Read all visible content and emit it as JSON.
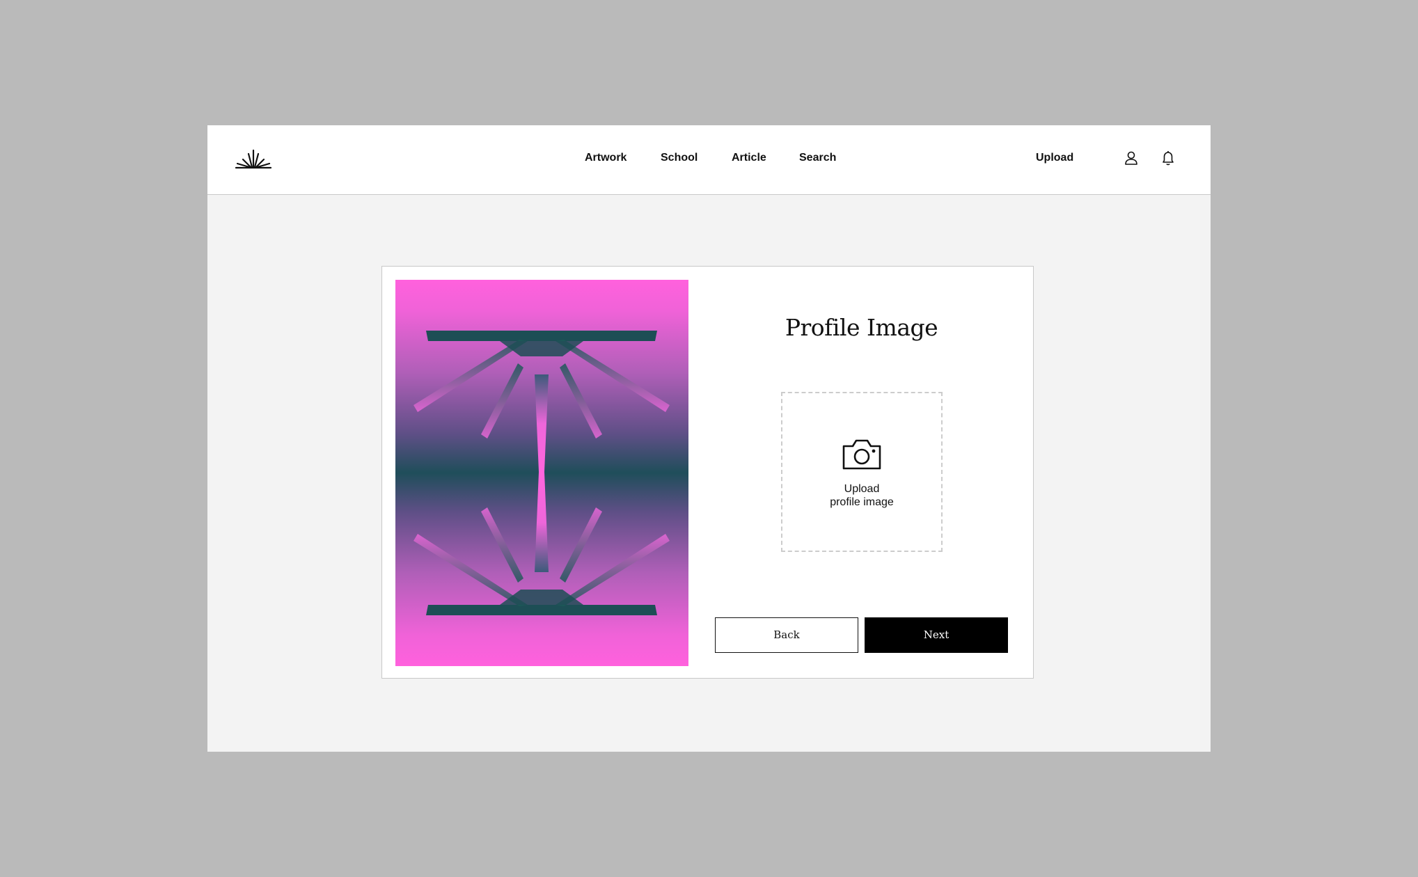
{
  "nav": {
    "links": [
      "Artwork",
      "School",
      "Article",
      "Search"
    ],
    "upload": "Upload",
    "icons": {
      "logo": "sunburst-logo",
      "profile": "user-icon",
      "notifications": "bell-icon"
    }
  },
  "modal": {
    "title": "Profile Image",
    "upload_box": {
      "icon": "camera-icon",
      "line1": "Upload",
      "line2": "profile image"
    },
    "back_label": "Back",
    "next_label": "Next"
  },
  "colors": {
    "page_background": "#bababa",
    "window_background": "#f3f3f3",
    "artwork_pink": "#ff61dd",
    "artwork_green": "#1f4e5a",
    "primary_button": "#000000"
  }
}
